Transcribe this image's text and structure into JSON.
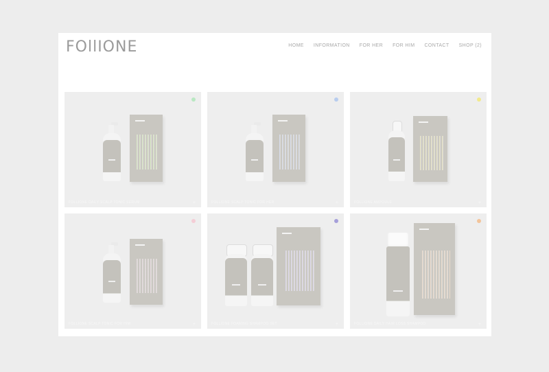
{
  "brand": {
    "logo": "FOllIONE"
  },
  "nav": {
    "items": [
      "HOME",
      "INFORMATION",
      "FOR HER",
      "FOR HIM",
      "CONTACT",
      "SHOP (2)"
    ]
  },
  "products": [
    {
      "caption": "FOLLIONE DAILY SCALP TONIC SERUM",
      "dot_color": "#b9e8c2",
      "stripe_tint": "#d9e8c6",
      "plus": "+"
    },
    {
      "caption": "FOLLIONE SCALP TONIC FOR HER",
      "dot_color": "#b8cdef",
      "stripe_tint": "#d6dcea",
      "plus": "+"
    },
    {
      "caption": "FOLLIONE AMPOULE",
      "dot_color": "#f2e98c",
      "stripe_tint": "#e6e3c4",
      "plus": "+"
    },
    {
      "caption": "FOLLIONE SCALP TONIC FOR HIM",
      "dot_color": "#f4cdd6",
      "stripe_tint": "#e4dade",
      "plus": "+"
    },
    {
      "caption": "FOLLIONE FOAMING SHAMPOO SET",
      "dot_color": "#a6a0da",
      "stripe_tint": "#dcd8ec",
      "plus": "+"
    },
    {
      "caption": "FOLLIONE DAILY HAIR LOSS SHAMPOO",
      "dot_color": "#f3c49a",
      "stripe_tint": "#eadbcc",
      "plus": "+"
    }
  ]
}
